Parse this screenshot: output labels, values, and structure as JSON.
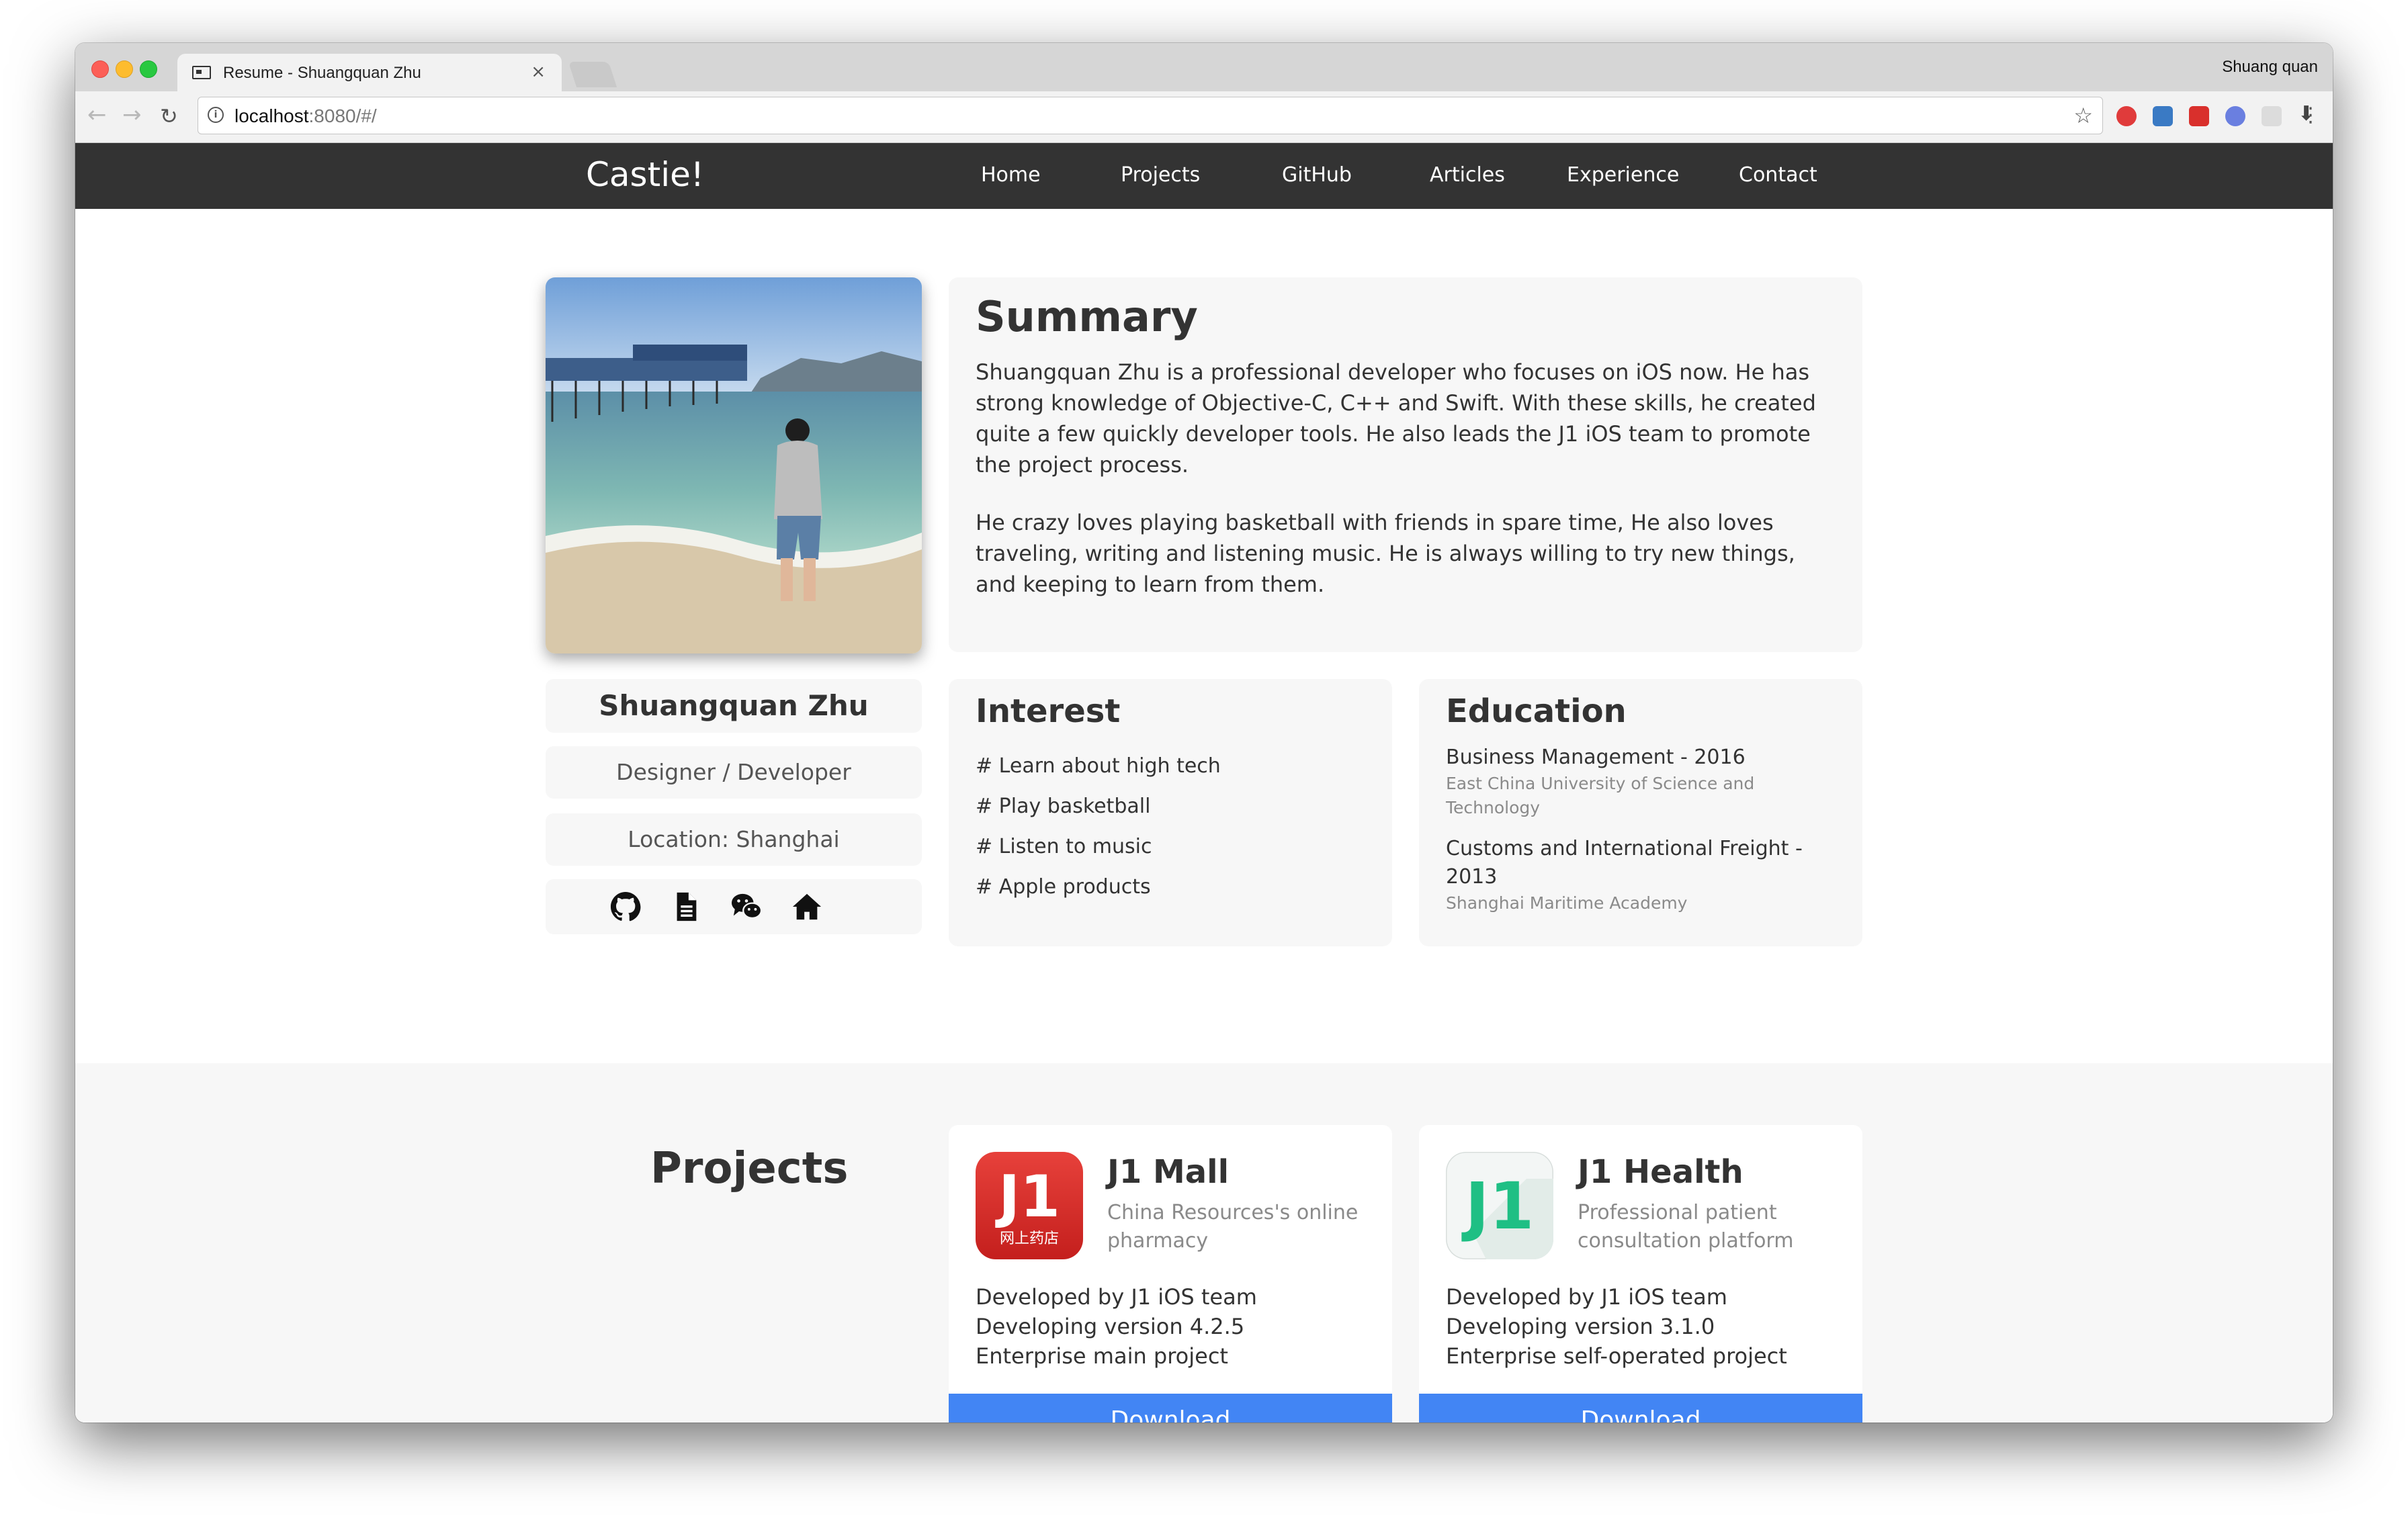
{
  "browser": {
    "tab_title": "Resume - Shuangquan Zhu",
    "tab_close": "×",
    "profile_name": "Shuang quan",
    "url_host": "localhost",
    "url_rest": ":8080/#/"
  },
  "site": {
    "brand": "Castie!",
    "nav": [
      "Home",
      "Projects",
      "GitHub",
      "Articles",
      "Experience",
      "Contact"
    ]
  },
  "summary": {
    "title": "Summary",
    "paragraphs": [
      "Shuangquan Zhu is a professional developer who focuses on iOS now. He has strong knowledge of Objective-C, C++ and Swift. With these skills, he created quite a few quickly developer tools. He also leads the J1 iOS team to promote the project process.",
      "He crazy loves playing basketball with friends in spare time, He also loves traveling, writing and listening music. He is always willing to try new things, and keeping to learn from them."
    ]
  },
  "profile": {
    "name": "Shuangquan Zhu",
    "role": "Designer / Developer",
    "location": "Location: Shanghai",
    "social_icons": [
      "github-icon",
      "document-icon",
      "wechat-icon",
      "home-icon"
    ]
  },
  "interest": {
    "title": "Interest",
    "items": [
      "# Learn about high tech",
      "# Play basketball",
      "# Listen to music",
      "# Apple products"
    ]
  },
  "education": {
    "title": "Education",
    "items": [
      {
        "degree": "Business Management - 2016",
        "school": "East China University of Science and Technology"
      },
      {
        "degree": "Customs and International Freight - 2013",
        "school": "Shanghai Maritime Academy"
      }
    ]
  },
  "projects": {
    "title": "Projects",
    "cards": [
      {
        "name": "J1 Mall",
        "desc": "China Resources's online pharmacy",
        "icon_text": "J1",
        "icon_subtext": "网上药店",
        "lines": [
          "Developed by J1 iOS team",
          "Developing version 4.2.5",
          "Enterprise main project"
        ],
        "button": "Download"
      },
      {
        "name": "J1 Health",
        "desc": "Professional patient consultation platform",
        "icon_text": "J1",
        "lines": [
          "Developed by J1 iOS team",
          "Developing version 3.1.0",
          "Enterprise self-operated project"
        ],
        "button": "Download"
      }
    ]
  },
  "colors": {
    "nav_bg": "#333333",
    "card_bg": "#f7f7f7",
    "download_button": "#4285f4",
    "mall_icon": "#d8302c",
    "health_icon": "#1fbf84"
  }
}
